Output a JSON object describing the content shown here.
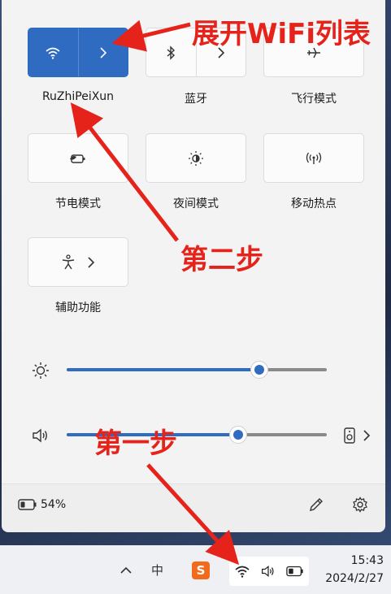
{
  "tiles": {
    "wifi": {
      "label": "RuZhiPeiXun"
    },
    "bluetooth": {
      "label": "蓝牙"
    },
    "airplane": {
      "label": "飞行模式"
    },
    "battery_saver": {
      "label": "节电模式"
    },
    "night_light": {
      "label": "夜间模式"
    },
    "hotspot": {
      "label": "移动热点"
    },
    "accessibility": {
      "label": "辅助功能"
    }
  },
  "sliders": {
    "brightness": {
      "level": 0.74
    },
    "volume": {
      "level": 0.66
    }
  },
  "footer": {
    "battery_text": "54%"
  },
  "taskbar": {
    "time": "15:43",
    "date": "2024/2/27",
    "ime": "中"
  },
  "annotations": {
    "expand_wifi": "展开WiFi列表",
    "step_two": "第二步",
    "step_one": "第一步"
  },
  "colors": {
    "accent": "#2f6bc0",
    "annotation": "#e5231b"
  }
}
